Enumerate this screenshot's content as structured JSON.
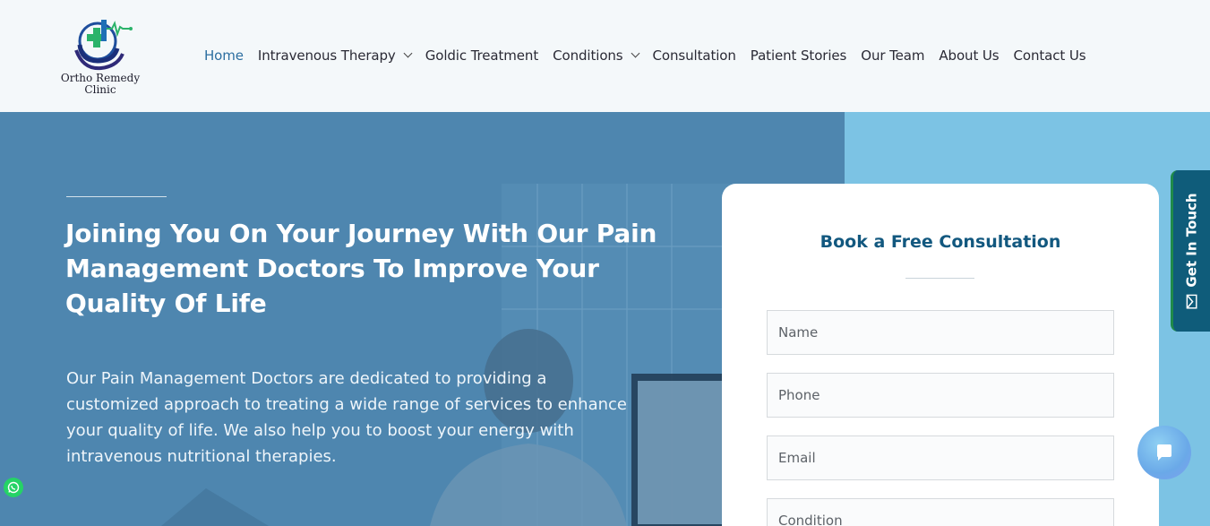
{
  "brand": {
    "name_line1": "Ortho Remedy",
    "name_line2": "Clinic",
    "icon": "ortho-remedy-logo"
  },
  "nav": {
    "items": [
      {
        "label": "Home",
        "active": true,
        "dropdown": false
      },
      {
        "label": "Intravenous Therapy",
        "active": false,
        "dropdown": true
      },
      {
        "label": "Goldic Treatment",
        "active": false,
        "dropdown": false
      },
      {
        "label": "Conditions",
        "active": false,
        "dropdown": true
      },
      {
        "label": "Consultation",
        "active": false,
        "dropdown": false
      },
      {
        "label": "Patient Stories",
        "active": false,
        "dropdown": false
      },
      {
        "label": "Our Team",
        "active": false,
        "dropdown": false
      },
      {
        "label": "About Us",
        "active": false,
        "dropdown": false
      },
      {
        "label": "Contact Us",
        "active": false,
        "dropdown": false
      }
    ]
  },
  "hero": {
    "title": "Joining You On Your Journey With Our Pain Management Doctors To Improve Your Quality Of Life",
    "description": "Our Pain Management Doctors are dedicated to providing a customized approach to treating a wide range of services to enhance your quality of life. We also help you to boost your energy with intravenous nutritional therapies."
  },
  "form": {
    "title": "Book a Free Consultation",
    "fields": {
      "name": {
        "placeholder": "Name",
        "value": ""
      },
      "phone": {
        "placeholder": "Phone",
        "value": ""
      },
      "email": {
        "placeholder": "Email",
        "value": ""
      },
      "condition": {
        "placeholder": "Condition",
        "value": ""
      }
    }
  },
  "side_tab": {
    "label": "Get In Touch",
    "icon": "mail-icon"
  },
  "floating": {
    "chat_icon": "chat-bubble-icon",
    "whatsapp_icon": "whatsapp-icon"
  },
  "colors": {
    "accent": "#2c6ea0",
    "hero_overlay": "#4f87b0",
    "hero_right": "#7cc3e4",
    "form_title": "#12587f",
    "side_tab": "#0f5c7a",
    "whatsapp": "#25d366"
  }
}
